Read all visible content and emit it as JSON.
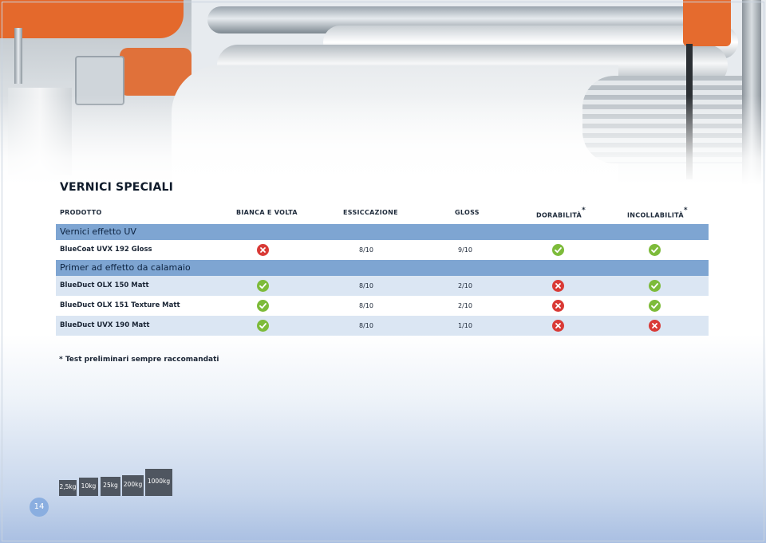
{
  "title": "VERNICI SPECIALI",
  "table": {
    "headers": {
      "product": "PRODOTTO",
      "bianca_volta": "BIANCA E VOLTA",
      "essiccazione": "ESSICCAZIONE",
      "gloss": "GLOSS",
      "durabilita": "DORABILITÀ",
      "incollabilita": "INCOLLABILITÀ",
      "asterisk": "*"
    },
    "groups": [
      {
        "label": "Vernici effetto UV",
        "rows": [
          {
            "name": "BlueCoat UVX 192 Gloss",
            "bianca_volta": "no",
            "essiccazione": "8/10",
            "gloss": "9/10",
            "durabilita": "yes",
            "incollabilita": "yes"
          }
        ]
      },
      {
        "label": "Primer ad effetto da calamaio",
        "rows": [
          {
            "name": "BlueDuct OLX 150 Matt",
            "bianca_volta": "yes",
            "essiccazione": "8/10",
            "gloss": "2/10",
            "durabilita": "no",
            "incollabilita": "yes"
          },
          {
            "name": "BlueDuct OLX 151 Texture Matt",
            "bianca_volta": "yes",
            "essiccazione": "8/10",
            "gloss": "2/10",
            "durabilita": "no",
            "incollabilita": "yes"
          },
          {
            "name": "BlueDuct UVX 190 Matt",
            "bianca_volta": "yes",
            "essiccazione": "8/10",
            "gloss": "1/10",
            "durabilita": "no",
            "incollabilita": "no"
          }
        ]
      }
    ]
  },
  "footnote": "* Test preliminari sempre raccomandati",
  "packaging": [
    "2,5kg",
    "10kg",
    "25kg",
    "200kg",
    "1000kg"
  ],
  "page_number": "14",
  "colors": {
    "group_header": "#7ea5d2",
    "row_alt": "#dbe6f3",
    "yes_icon": "#7dbb3a",
    "no_icon": "#d93a36",
    "size_box": "#4f5660"
  },
  "icons": {
    "yes": "check-circle-icon",
    "no": "x-circle-icon"
  }
}
